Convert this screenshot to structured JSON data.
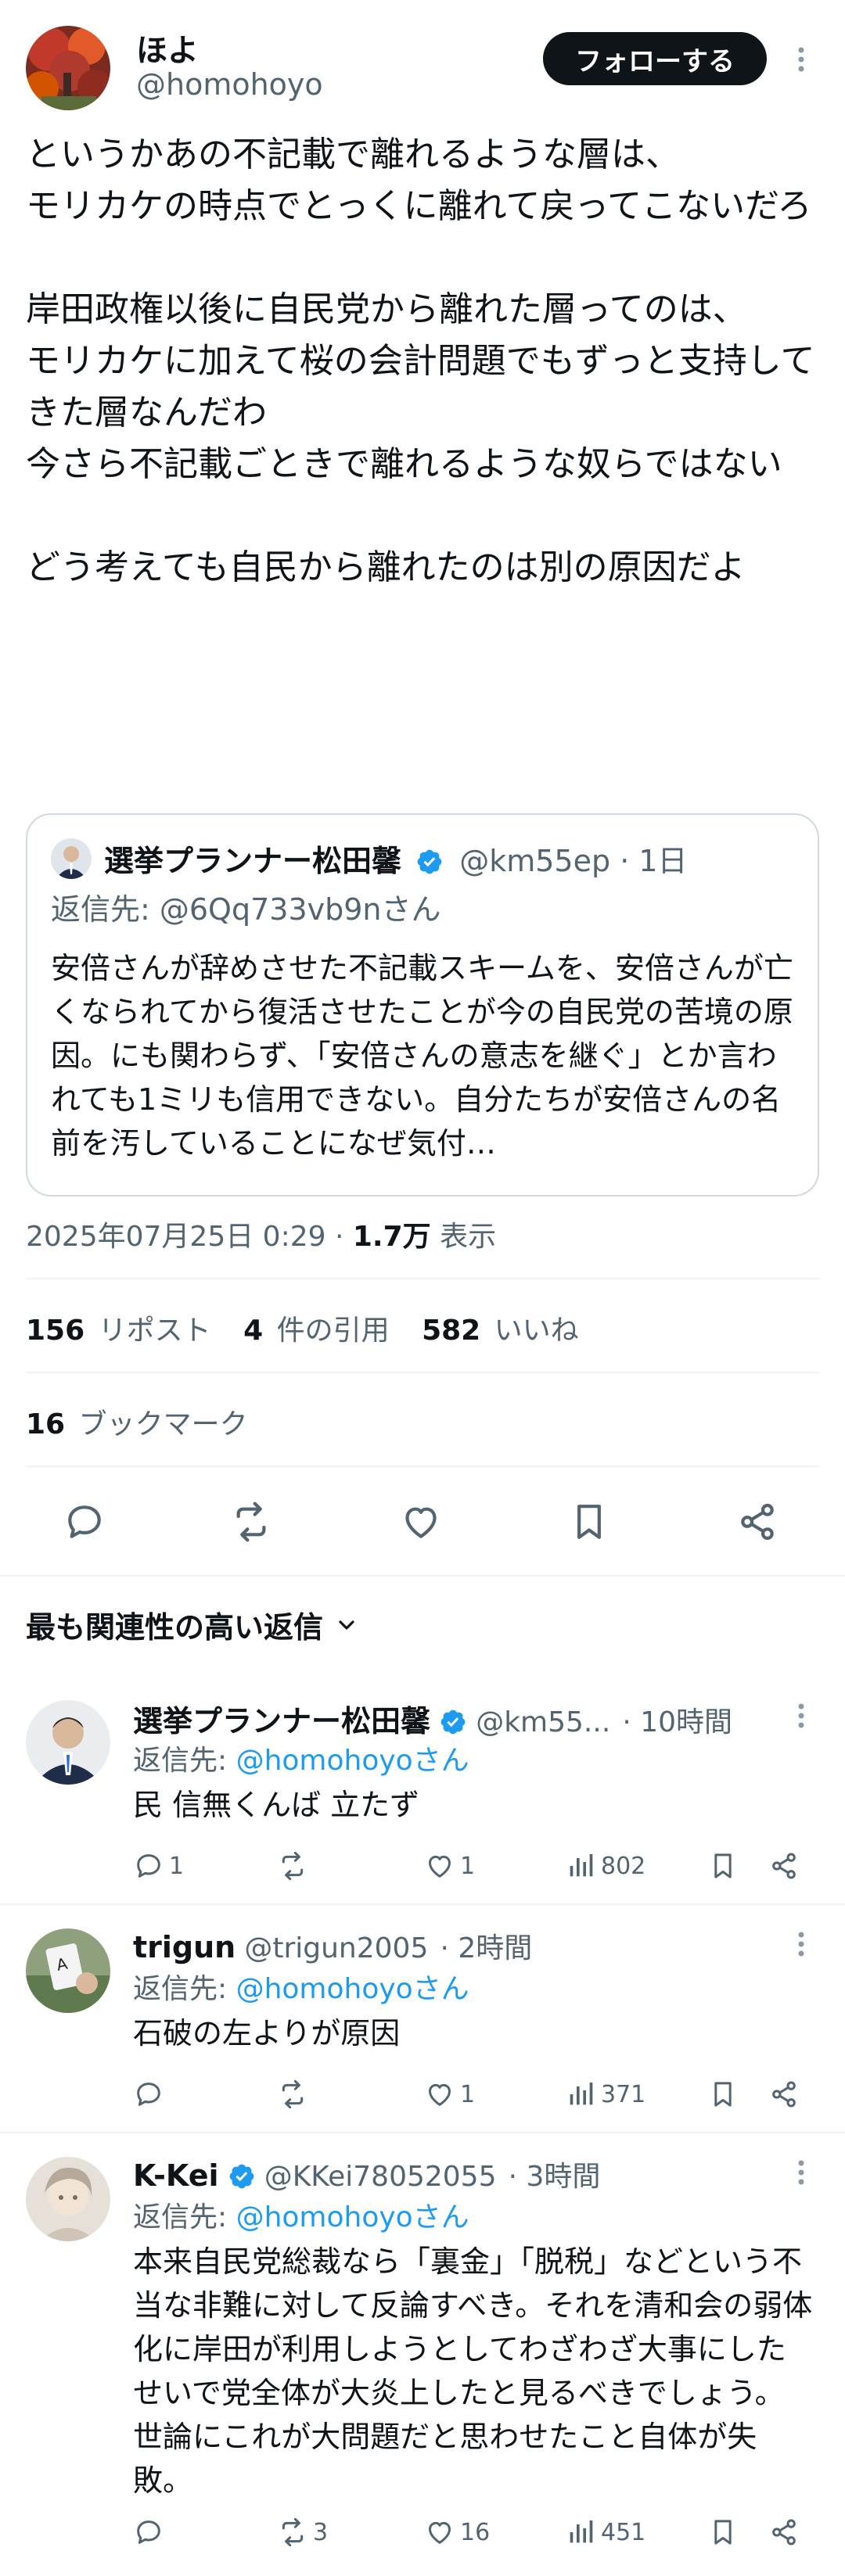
{
  "author": {
    "display_name": "ほよ",
    "handle": "@homohoyo",
    "follow_label": "フォローする"
  },
  "tweet": {
    "text": "というかあの不記載で離れるような層は、\nモリカケの時点でとっくに離れて戻ってこないだろ\n\n岸田政権以後に自民党から離れた層ってのは、\nモリカケに加えて桜の会計問題でもずっと支持してきた層なんだわ\n今さら不記載ごときで離れるような奴らではない\n\nどう考えても自民から離れたのは別の原因だよ"
  },
  "quote": {
    "display_name": "選挙プランナー松田馨",
    "handle": "@km55ep",
    "time": "· 1日",
    "reply_to": "返信先: @6Qq733vb9nさん",
    "text": "安倍さんが辞めさせた不記載スキームを、安倍さんが亡くなられてから復活させたことが今の自民党の苦境の原因。にも関わらず、「安倍さんの意志を継ぐ」とか言われても1ミリも信用できない。自分たちが安倍さんの名前を汚していることになぜ気付…"
  },
  "meta": {
    "timestamp": "2025年07月25日 0:29 · ",
    "views_count": "1.7万",
    "views_label": " 表示"
  },
  "stats": {
    "reposts_count": "156",
    "reposts_label": "リポスト",
    "quotes_count": "4",
    "quotes_label": "件の引用",
    "likes_count": "582",
    "likes_label": "いいね",
    "bookmarks_count": "16",
    "bookmarks_label": "ブックマーク"
  },
  "sort": {
    "label": "最も関連性の高い返信"
  },
  "replies": [
    {
      "display_name": "選挙プランナー松田馨",
      "verified": true,
      "handle": "@km55...",
      "time": "· 10時間",
      "reply_prefix": "返信先: ",
      "reply_to": "@homohoyoさん",
      "text": "民 信無くんば 立たず",
      "reply_count": "1",
      "repost_count": "",
      "like_count": "1",
      "view_count": "802"
    },
    {
      "display_name": "trigun",
      "verified": false,
      "handle": "@trigun2005",
      "time": "· 2時間",
      "reply_prefix": "返信先: ",
      "reply_to": "@homohoyoさん",
      "text": "石破の左よりが原因",
      "reply_count": "",
      "repost_count": "",
      "like_count": "1",
      "view_count": "371"
    },
    {
      "display_name": "K-Kei",
      "verified": true,
      "handle": "@KKei78052055",
      "time": "· 3時間",
      "reply_prefix": "返信先: ",
      "reply_to": "@homohoyoさん",
      "text": "本来自民党総裁なら「裏金」「脱税」などという不当な非難に対して反論すべき。それを清和会の弱体化に岸田が利用しようとしてわざわざ大事にしたせいで党全体が大炎上したと見るべきでしょう。世論にこれが大問題だと思わせたこと自体が失敗。",
      "reply_count": "",
      "repost_count": "3",
      "like_count": "16",
      "view_count": "451"
    }
  ],
  "colors": {
    "text": "#0f1419",
    "muted": "#536471",
    "link": "#1d9bf0",
    "verified": "#1d9bf0",
    "divider": "#eff3f4",
    "follow_bg": "#0f1419"
  }
}
